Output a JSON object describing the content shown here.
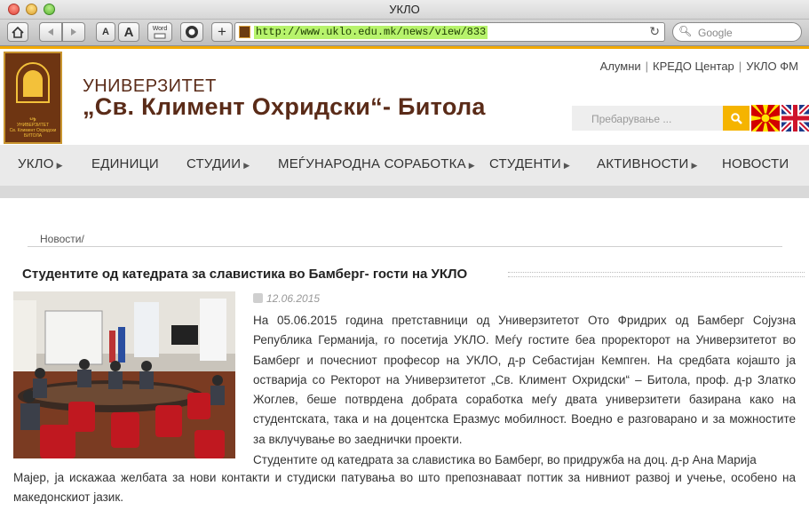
{
  "window": {
    "title": "УКЛО"
  },
  "toolbar": {
    "font_small": "A",
    "font_large": "A",
    "word_label": "Word",
    "add_label": "+",
    "url": "http://www.uklo.edu.mk/news/view/833",
    "search_placeholder": "Google"
  },
  "site": {
    "title_line1": "УНИВЕРЗИТЕТ",
    "title_line2": "„Св. Климент Охридски“- Битола",
    "logo_text": "УНИВЕРЗИТЕТ СВ. КЛИМЕНТ ОХРИДСКИ БИТОЛА",
    "top_links": [
      "Алумни",
      "КРЕДО Центар",
      "УКЛО ФМ"
    ],
    "search_placeholder": "Пребарување ..."
  },
  "nav": {
    "items": [
      {
        "label": "УКЛО"
      },
      {
        "label": "ЕДИНИЦИ"
      },
      {
        "label": "СТУДИИ"
      },
      {
        "label": "МЕЃУНАРОДНА СОРАБОТКА"
      },
      {
        "label": "СТУДЕНТИ"
      },
      {
        "label": "АКТИВНОСТИ"
      },
      {
        "label": "НОВОСТИ"
      }
    ]
  },
  "article": {
    "breadcrumb": "Новости/",
    "title": "Студентите од катедрата за славистика во Бамберг- гости на УКЛО",
    "date": "12.06.2015",
    "para1": "На 05.06.2015 година претставници од Универзитетот Ото Фридрих од Бамберг Сојузна Република Германија, го посетија УКЛО. Меѓу гостите беа проректорот на Универзитетот во Бамберг и почесниот професор на УКЛО,  д-р Себастијан Кемпген. На средбата којашто ја оствариja со Ректорот на Универзитетот „Св. Климент Охридски“ – Битола, проф. д-р Златко Жоглев, беше потврдена добрата соработка меѓу двата универзитети базирана како на студентската, така и на доцентска Еразмус мобилност. Воедно е разговарано и за можностите за вклучување во заеднички проекти.",
    "para2": "Студентите од катедрата за славистика  во Бамберг, во придружба на доц.  д-р Ана Марија",
    "para3": "Мајер, ја искажаа желбата за нови контакти и студиски патувања во што препознаваат поттик за нивниот развој и учење, особено на македонскиот јазик."
  }
}
